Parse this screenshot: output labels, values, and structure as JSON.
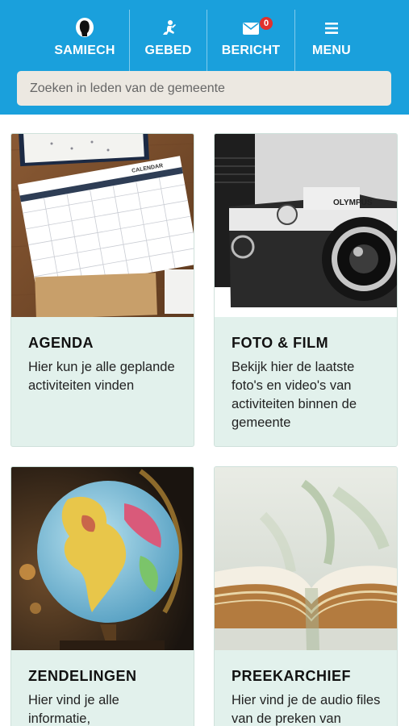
{
  "header": {
    "nav": [
      {
        "id": "profile",
        "label": "SAMIECH",
        "icon": "person-silhouette-icon"
      },
      {
        "id": "prayer",
        "label": "GEBED",
        "icon": "kneeling-pray-icon"
      },
      {
        "id": "message",
        "label": "BERICHT",
        "icon": "envelope-icon",
        "badge": "0"
      },
      {
        "id": "menu",
        "label": "MENU",
        "icon": "hamburger-icon"
      }
    ],
    "search_placeholder": "Zoeken in leden van de gemeente"
  },
  "cards": [
    {
      "title": "AGENDA",
      "desc": "Hier kun je alle geplande activiteiten vinden",
      "image": "calendar-photo",
      "image_label": "CALENDAR"
    },
    {
      "title": "FOTO & FILM",
      "desc": "Bekijk hier de laatste foto's en video's van activiteiten binnen de gemeente",
      "image": "camera-photo",
      "image_label": "OLYMPUS"
    },
    {
      "title": "ZENDELINGEN",
      "desc": "Hier vind je alle informatie,",
      "image": "globe-photo"
    },
    {
      "title": "PREEKARCHIEF",
      "desc": "Hier vind je de audio files van de preken van",
      "image": "open-book-photo"
    }
  ],
  "colors": {
    "header": "#1aa0dc",
    "card_bg": "#e2f1ec",
    "badge": "#e0312d"
  }
}
